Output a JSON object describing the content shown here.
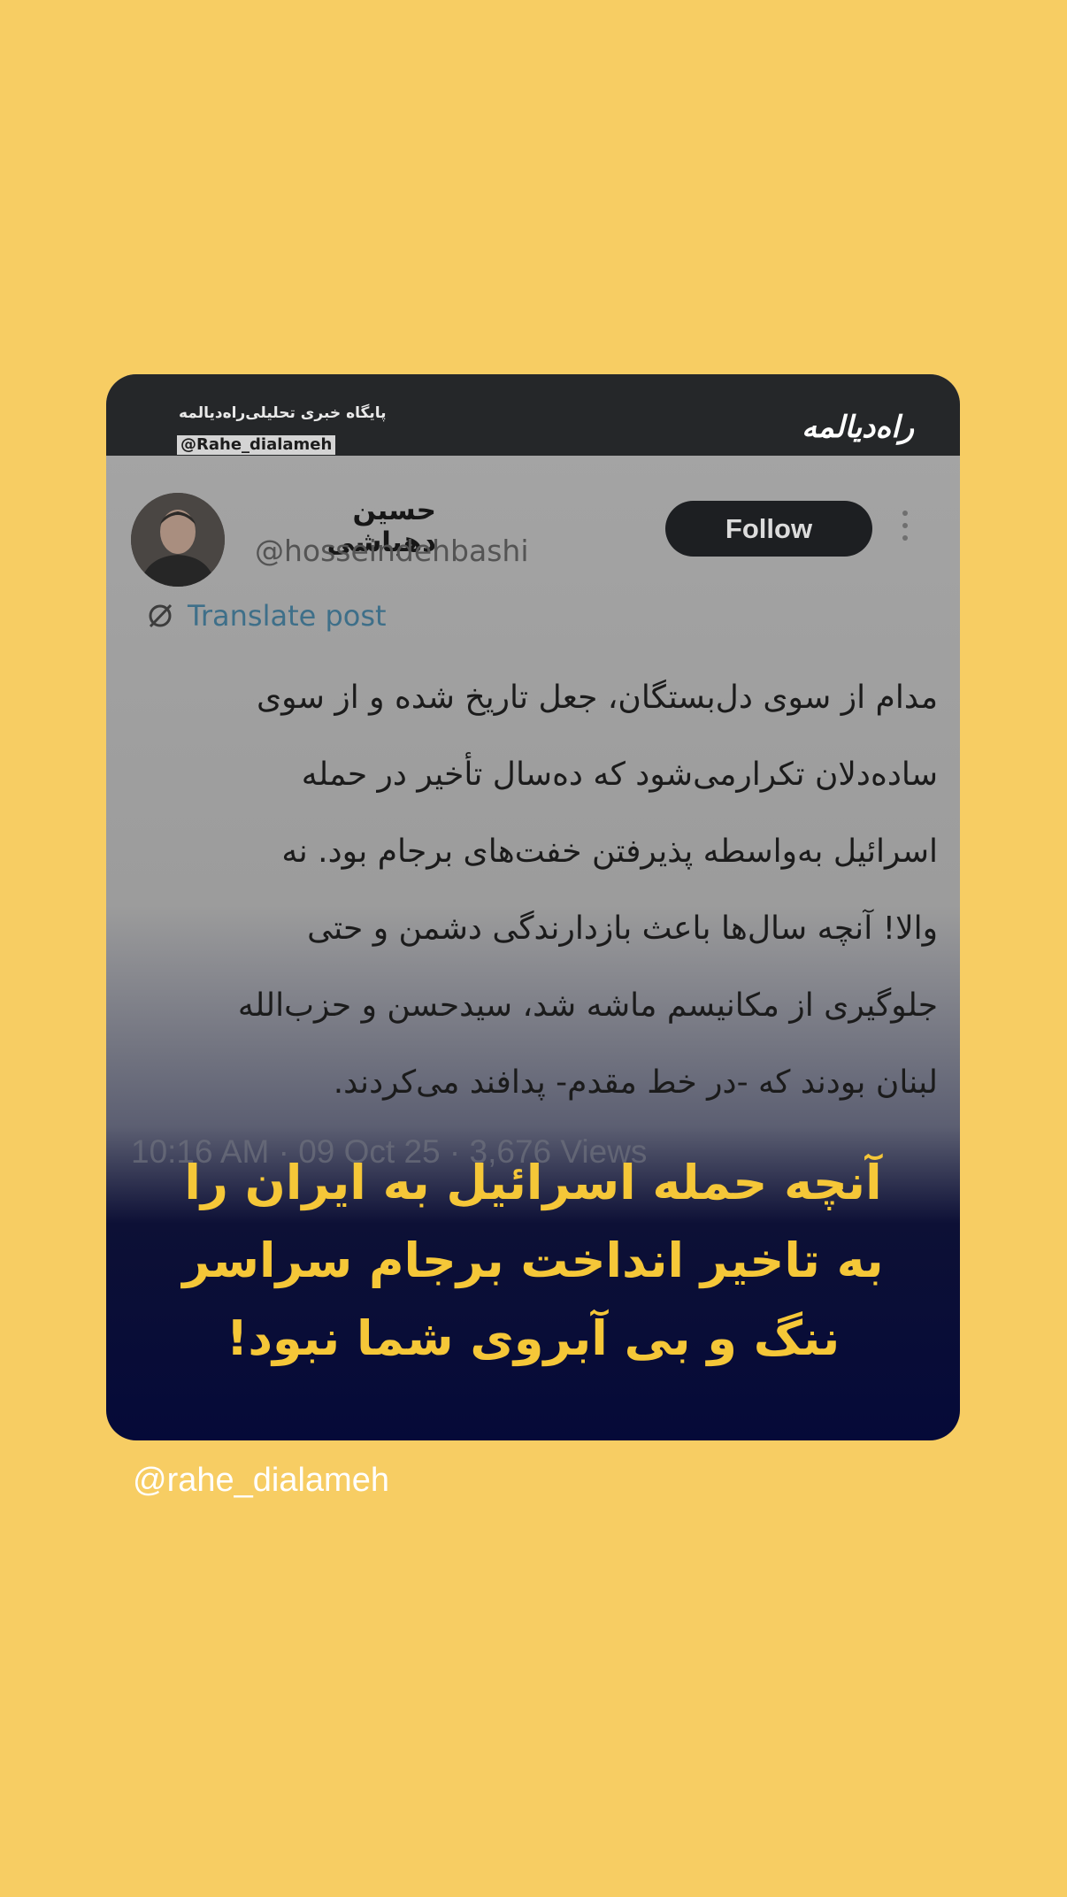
{
  "card": {
    "site_name": "پایگاه خبری تحلیلی‌راه‌دیالمه",
    "site_handle": "@Rahe_dialameh",
    "logo": "راه‌دیالمه"
  },
  "tweet": {
    "author_name": "حسین دهباشی",
    "author_handle": "@hosseindehbashi",
    "follow_label": "Follow",
    "translate_label": "Translate post",
    "lines": [
      "مدام از سوی دل‌بستگان، جعل تاریخ شده و از سوی",
      "ساده‌دلان تکرارمی‌شود که ده‌سال تأخیر در حمله",
      "اسرائیل به‌واسطه پذیرفتن خفت‌های برجام بود. نه",
      "والا! آنچه سال‌ها باعث بازدارندگی دشمن و حتی",
      "جلوگیری از مکانیسم ماشه شد، سیدحسن و حزب‌الله",
      "لبنان بودند که -در خط مقدم- پدافند می‌کردند."
    ],
    "meta": "10:16 AM · 09 Oct 25 · 3,676 Views"
  },
  "headline": {
    "lines": [
      "آنچه حمله اسرائیل به ایران را",
      "به تاخیر انداخت برجام سراسر",
      "ننگ و بی آبروی شما نبود!"
    ]
  },
  "footer": {
    "handle": "@rahe_dialameh"
  },
  "colors": {
    "background": "#f7cd63",
    "headline": "#f5c738",
    "card_bottom": "#050a38"
  }
}
